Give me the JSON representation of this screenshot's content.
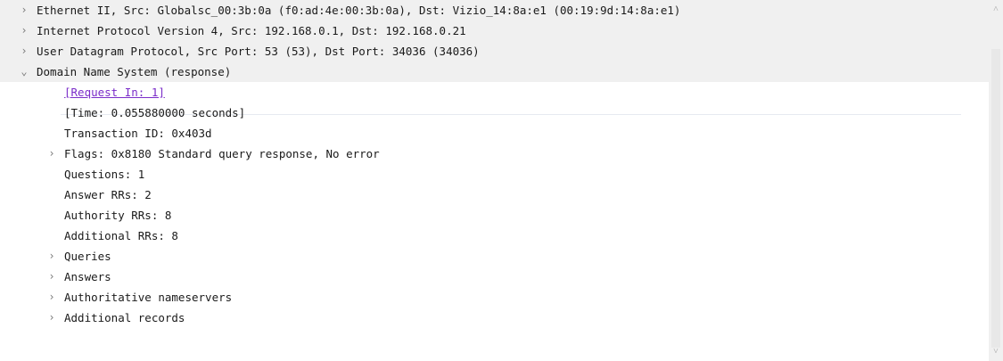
{
  "rows": [
    {
      "label": "Ethernet II, Src: Globalsc_00:3b:0a (f0:ad:4e:00:3b:0a), Dst: Vizio_14:8a:e1 (00:19:9d:14:8a:e1)",
      "expander": "collapsed"
    },
    {
      "label": "Internet Protocol Version 4, Src: 192.168.0.1, Dst: 192.168.0.21",
      "expander": "collapsed"
    },
    {
      "label": "User Datagram Protocol, Src Port: 53 (53), Dst Port: 34036 (34036)",
      "expander": "collapsed"
    },
    {
      "label": "Domain Name System (response)",
      "expander": "expanded"
    },
    {
      "label": "[Request In: 1]",
      "expander": "none"
    },
    {
      "label": "[Time: 0.055880000 seconds]",
      "expander": "none"
    },
    {
      "label": "Transaction ID: 0x403d",
      "expander": "none"
    },
    {
      "label": "Flags: 0x8180 Standard query response, No error",
      "expander": "collapsed"
    },
    {
      "label": "Questions: 1",
      "expander": "none"
    },
    {
      "label": "Answer RRs: 2",
      "expander": "none"
    },
    {
      "label": "Authority RRs: 8",
      "expander": "none"
    },
    {
      "label": "Additional RRs: 8",
      "expander": "none"
    },
    {
      "label": "Queries",
      "expander": "collapsed"
    },
    {
      "label": "Answers",
      "expander": "collapsed"
    },
    {
      "label": "Authoritative nameservers",
      "expander": "collapsed"
    },
    {
      "label": "Additional records",
      "expander": "collapsed"
    }
  ],
  "glyphs": {
    "collapsed": "›",
    "expanded": "⌄",
    "scroll_up": "˄",
    "scroll_down": "˅"
  },
  "colors": {
    "link": "#7b2dc9",
    "selected_bg": "#f0f0f0"
  }
}
